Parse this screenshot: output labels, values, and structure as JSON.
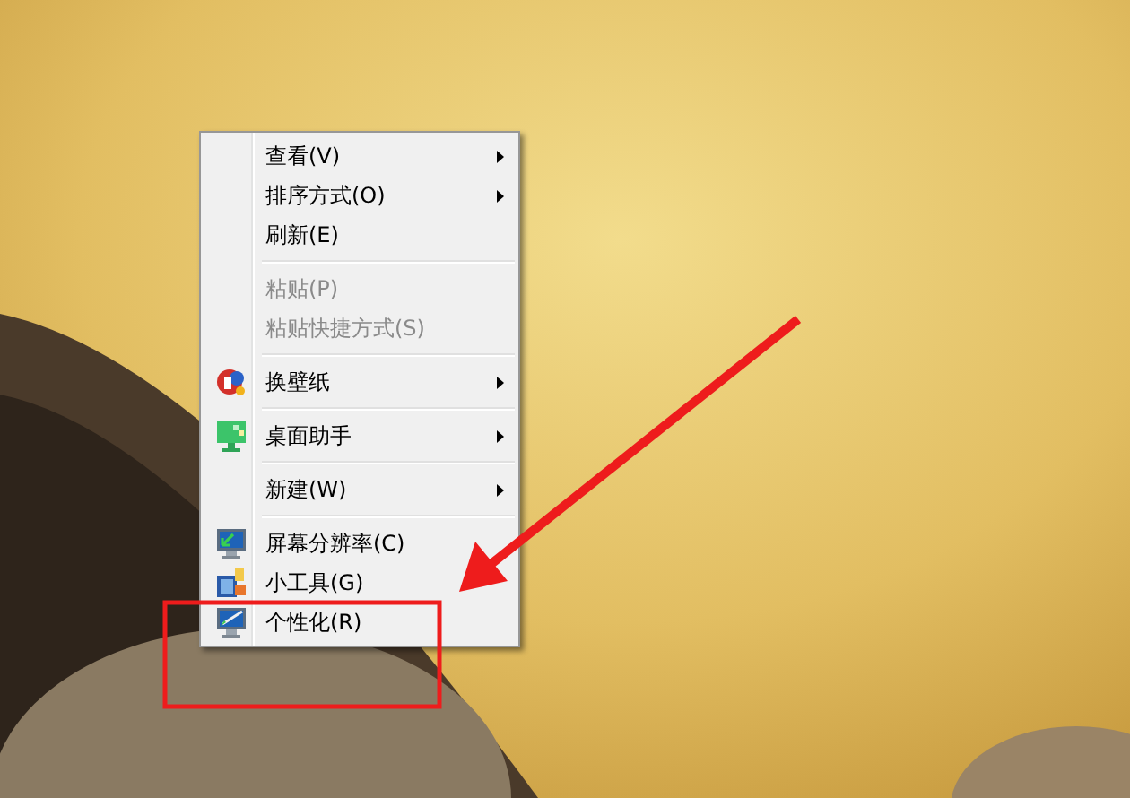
{
  "context_menu": {
    "groups": [
      [
        {
          "label": "查看(V)",
          "kind": "plain",
          "disabled": false,
          "submenu": true
        },
        {
          "label": "排序方式(O)",
          "kind": "plain",
          "disabled": false,
          "submenu": true
        },
        {
          "label": "刷新(E)",
          "kind": "plain",
          "disabled": false,
          "submenu": false
        }
      ],
      [
        {
          "label": "粘贴(P)",
          "kind": "plain",
          "disabled": true,
          "submenu": false
        },
        {
          "label": "粘贴快捷方式(S)",
          "kind": "plain",
          "disabled": true,
          "submenu": false
        }
      ],
      [
        {
          "label": "换壁纸",
          "kind": "wallpaper",
          "disabled": false,
          "submenu": true
        }
      ],
      [
        {
          "label": "桌面助手",
          "kind": "assistant",
          "disabled": false,
          "submenu": true
        }
      ],
      [
        {
          "label": "新建(W)",
          "kind": "plain",
          "disabled": false,
          "submenu": true
        }
      ],
      [
        {
          "label": "屏幕分辨率(C)",
          "kind": "display",
          "disabled": false,
          "submenu": false
        },
        {
          "label": "小工具(G)",
          "kind": "gadgets",
          "disabled": false,
          "submenu": false
        },
        {
          "label": "个性化(R)",
          "kind": "personalize",
          "disabled": false,
          "submenu": false
        }
      ]
    ]
  }
}
